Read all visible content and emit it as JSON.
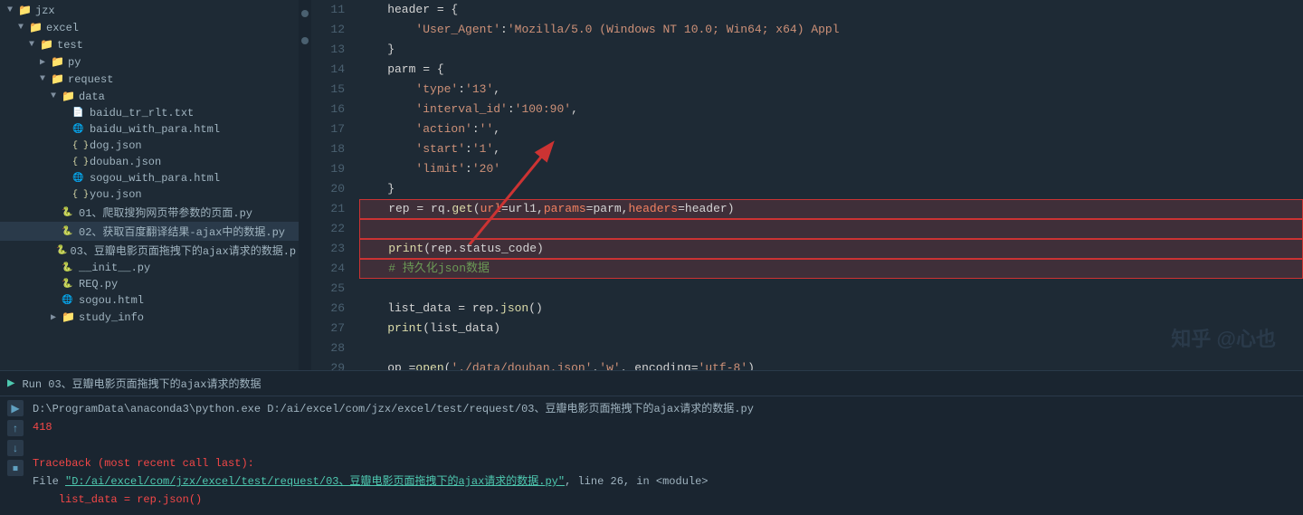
{
  "sidebar": {
    "items": [
      {
        "label": "jzx",
        "level": 1,
        "type": "folder",
        "arrow": "▼"
      },
      {
        "label": "excel",
        "level": 2,
        "type": "folder",
        "arrow": "▼"
      },
      {
        "label": "test",
        "level": 3,
        "type": "folder",
        "arrow": "▼"
      },
      {
        "label": "py",
        "level": 4,
        "type": "folder",
        "arrow": "▶"
      },
      {
        "label": "request",
        "level": 4,
        "type": "folder",
        "arrow": "▼"
      },
      {
        "label": "data",
        "level": 5,
        "type": "folder",
        "arrow": "▼"
      },
      {
        "label": "baidu_tr_rlt.txt",
        "level": 6,
        "type": "txt"
      },
      {
        "label": "baidu_with_para.html",
        "level": 6,
        "type": "html"
      },
      {
        "label": "dog.json",
        "level": 6,
        "type": "json"
      },
      {
        "label": "douban.json",
        "level": 6,
        "type": "json"
      },
      {
        "label": "sogou_with_para.html",
        "level": 6,
        "type": "html"
      },
      {
        "label": "you.json",
        "level": 6,
        "type": "json"
      },
      {
        "label": "01、爬取搜狗网页带参数的页面.py",
        "level": 5,
        "type": "py"
      },
      {
        "label": "02、获取百度翻译结果-ajax中的数据.py",
        "level": 5,
        "type": "py",
        "selected": true
      },
      {
        "label": "03、豆瓣电影页面拖拽下的ajax请求的数据.p",
        "level": 5,
        "type": "py"
      },
      {
        "label": "__init__.py",
        "level": 5,
        "type": "py"
      },
      {
        "label": "REQ.py",
        "level": 5,
        "type": "py"
      },
      {
        "label": "sogou.html",
        "level": 5,
        "type": "html"
      },
      {
        "label": "study_info",
        "level": 5,
        "type": "folder",
        "arrow": "▶"
      }
    ]
  },
  "code": {
    "lines": [
      {
        "num": 11,
        "content": "    header = {"
      },
      {
        "num": 12,
        "content": "        'User_Agent': 'Mozilla/5.0 (Windows NT 10.0; Win64; x64) Appl"
      },
      {
        "num": 13,
        "content": "    }"
      },
      {
        "num": 14,
        "content": "    parm = {"
      },
      {
        "num": 15,
        "content": "        'type': '13',"
      },
      {
        "num": 16,
        "content": "        'interval_id': '100:90',"
      },
      {
        "num": 17,
        "content": "        'action': '',"
      },
      {
        "num": 18,
        "content": "        'start': '1',"
      },
      {
        "num": 19,
        "content": "        'limit': '20'"
      },
      {
        "num": 20,
        "content": "    }"
      },
      {
        "num": 21,
        "content": "    rep = rq.get(url=url1, params=parm, headers=header)"
      },
      {
        "num": 22,
        "content": ""
      },
      {
        "num": 23,
        "content": "    print(rep.status_code)"
      },
      {
        "num": 24,
        "content": "    # 持久化json数据"
      },
      {
        "num": 25,
        "content": ""
      },
      {
        "num": 26,
        "content": "    list_data = rep.json()"
      },
      {
        "num": 27,
        "content": "    print(list_data)"
      },
      {
        "num": 28,
        "content": ""
      },
      {
        "num": 29,
        "content": "    op = open('./data/douban.json', 'w', encoding='utf-8')"
      }
    ]
  },
  "bottom": {
    "run_tab": "Run  03、豆瓣电影页面拖拽下的ajax请求的数据",
    "output_lines": [
      {
        "text": "D:\\ProgramData\\anaconda3\\python.exe D:/ai/excel/com/jzx/excel/test/request/03、豆瓣电影页面拖拽下的ajax请求的数据.py",
        "type": "normal"
      },
      {
        "text": "418",
        "type": "error"
      },
      {
        "text": "",
        "type": "normal"
      },
      {
        "text": "Traceback (most recent call last):",
        "type": "error"
      },
      {
        "text": "  File \"D:/ai/excel/com/jzx/excel/test/request/03、豆瓣电影页面拖拽下的ajax请求的数据.py\", line 26, in <module>",
        "type": "path"
      },
      {
        "text": "    list_data = rep.json()",
        "type": "error"
      }
    ]
  },
  "watermark": "知乎 @心也"
}
